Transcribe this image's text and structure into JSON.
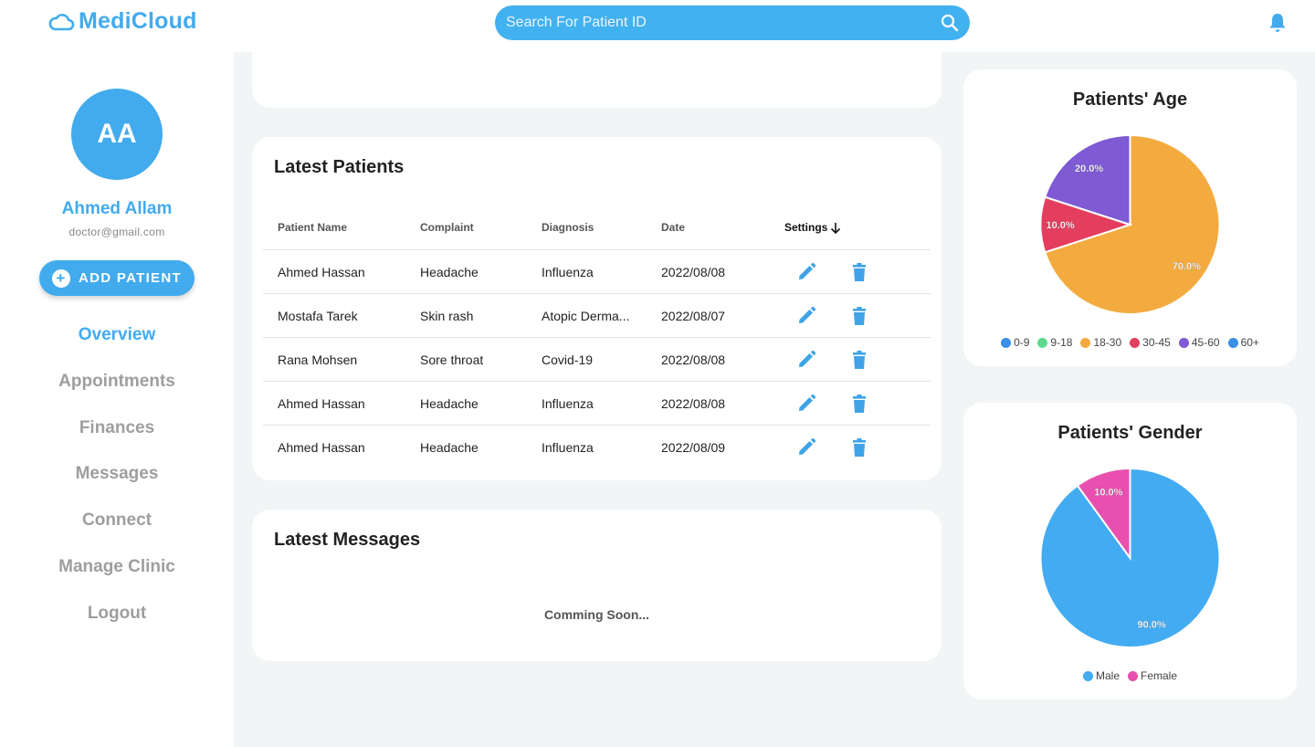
{
  "header": {
    "brand": "MediCloud",
    "search_placeholder": "Search For Patient ID"
  },
  "sidebar": {
    "avatar_initials": "AA",
    "user_name": "Ahmed Allam",
    "user_email": "doctor@gmail.com",
    "add_button_label": "ADD PATIENT",
    "nav": [
      {
        "label": "Overview",
        "active": true
      },
      {
        "label": "Appointments"
      },
      {
        "label": "Finances"
      },
      {
        "label": "Messages"
      },
      {
        "label": "Connect"
      },
      {
        "label": "Manage Clinic"
      },
      {
        "label": "Logout"
      }
    ]
  },
  "latest_patients": {
    "title": "Latest Patients",
    "columns": [
      "Patient Name",
      "Complaint",
      "Diagnosis",
      "Date",
      "Settings"
    ],
    "rows": [
      {
        "name": "Ahmed Hassan",
        "complaint": "Headache",
        "diagnosis": "Influenza",
        "date": "2022/08/08"
      },
      {
        "name": "Mostafa Tarek",
        "complaint": "Skin rash",
        "diagnosis": "Atopic Derma...",
        "date": "2022/08/07"
      },
      {
        "name": "Rana Mohsen",
        "complaint": "Sore throat",
        "diagnosis": "Covid-19",
        "date": "2022/08/08"
      },
      {
        "name": "Ahmed Hassan",
        "complaint": "Headache",
        "diagnosis": "Influenza",
        "date": "2022/08/08"
      },
      {
        "name": "Ahmed Hassan",
        "complaint": "Headache",
        "diagnosis": "Influenza",
        "date": "2022/08/09"
      }
    ]
  },
  "latest_messages": {
    "title": "Latest Messages",
    "placeholder": "Comming Soon..."
  },
  "colors": {
    "accent": "#42abed",
    "icon": "#3fa3e6"
  },
  "chart_data": [
    {
      "type": "pie",
      "title": "Patients' Age",
      "categories": [
        "0-9",
        "9-18",
        "18-30",
        "30-45",
        "45-60",
        "60+"
      ],
      "values": [
        0,
        0,
        70,
        10,
        20,
        0
      ],
      "labels": [
        "",
        "",
        "70.0%",
        "10.0%",
        "20.0%",
        ""
      ],
      "colors": [
        "#3a8fe6",
        "#5ed98f",
        "#f3ab3f",
        "#e43e5e",
        "#7e5ad4",
        "#3a8fe6"
      ],
      "legend": "bottom"
    },
    {
      "type": "pie",
      "title": "Patients' Gender",
      "categories": [
        "Male",
        "Female"
      ],
      "values": [
        90,
        10
      ],
      "labels": [
        "90.0%",
        "10.0%"
      ],
      "colors": [
        "#42abf2",
        "#e84fae"
      ],
      "legend": "bottom"
    }
  ]
}
